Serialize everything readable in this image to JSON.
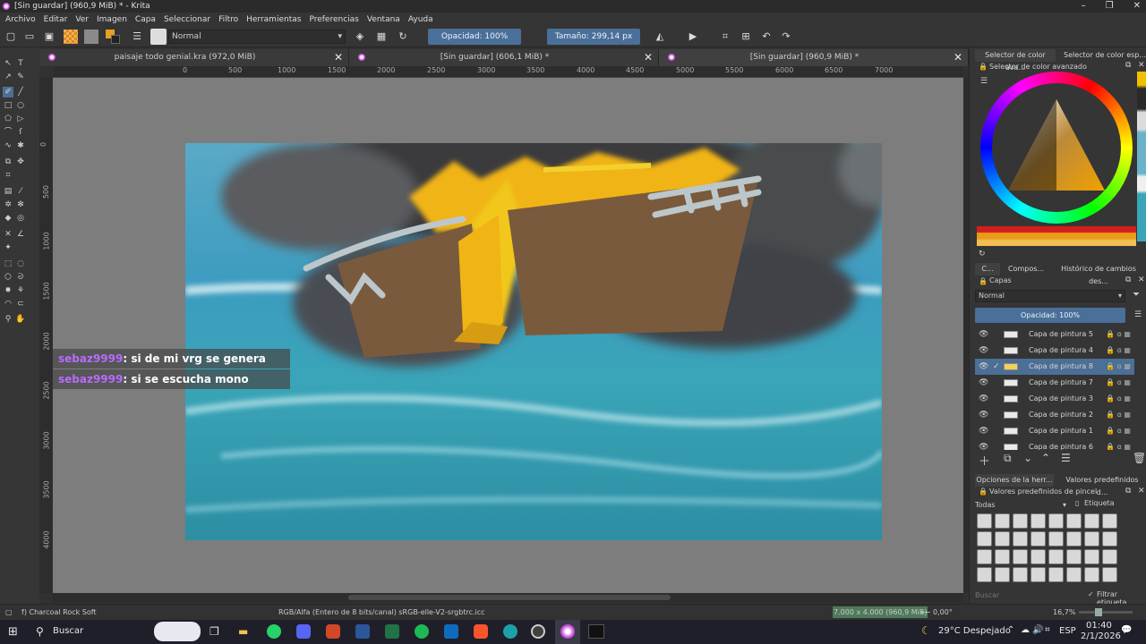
{
  "window": {
    "title": "[Sin guardar]  (960,9 MiB) * - Krita",
    "min": "–",
    "max": "❐",
    "close": "✕"
  },
  "menu": [
    "Archivo",
    "Editar",
    "Ver",
    "Imagen",
    "Capa",
    "Seleccionar",
    "Filtro",
    "Herramientas",
    "Preferencias",
    "Ventana",
    "Ayuda"
  ],
  "toolbar": {
    "blend_mode": "Normal",
    "opacity": "Opacidad: 100%",
    "size": "Tamaño: 299,14 px"
  },
  "tabs": [
    {
      "label": "paisaje todo genial.kra (972,0 MiB)"
    },
    {
      "label": "[Sin guardar]  (606,1 MiB) *"
    },
    {
      "label": "[Sin guardar]  (960,9 MiB) *"
    }
  ],
  "ruler_top": [
    "0",
    "500",
    "1000",
    "1500",
    "2000",
    "2500",
    "3000",
    "3500",
    "4000",
    "4500",
    "5000",
    "5500",
    "6000",
    "6500",
    "7000"
  ],
  "ruler_left": [
    "0",
    "500",
    "1000",
    "1500",
    "2000",
    "2500",
    "3000",
    "3500",
    "4000"
  ],
  "chat": [
    {
      "user": "sebaz9999",
      "msg": ": si de mi vrg se genera"
    },
    {
      "user": "sebaz9999",
      "msg": ": si se escucha mono"
    }
  ],
  "right_panel": {
    "top_tabs": [
      "Selector de color ava...",
      "Selector de color esp..."
    ],
    "color_header": "Selector de color avanzado",
    "mid_tabs": [
      "C...",
      "Compos...",
      "Histórico de cambios des..."
    ],
    "layers_header": "Capas",
    "layers_blend": "Normal",
    "layers_opacity": "Opacidad:  100%",
    "layers": [
      {
        "name": "Capa de pintura 5",
        "selected": false
      },
      {
        "name": "Capa de pintura 4",
        "selected": false
      },
      {
        "name": "Capa de pintura 8",
        "selected": true
      },
      {
        "name": "Capa de pintura 7",
        "selected": false
      },
      {
        "name": "Capa de pintura 3",
        "selected": false
      },
      {
        "name": "Capa de pintura 2",
        "selected": false
      },
      {
        "name": "Capa de pintura 1",
        "selected": false
      },
      {
        "name": "Capa de pintura 6",
        "selected": false
      }
    ],
    "bottom_tabs": [
      "Opciones de la herr...",
      "Valores predefinidos d..."
    ],
    "brush_header": "Valores predefinidos de pincel",
    "brush_filter": "Todas",
    "brush_tag": "Etiqueta",
    "search_placeholder": "Buscar",
    "filter_tag": "Filtrar etiqueta"
  },
  "status": {
    "brush": "f) Charcoal Rock Soft",
    "color_model": "RGB/Alfa (Entero de 8 bits/canal)  sRGB-elle-V2-srgbtrc.icc",
    "dimensions": "7.000 x 4.000 (960,9 MiB)",
    "rotation": "0,00°",
    "zoom": "16,7%"
  },
  "taskbar": {
    "search": "Buscar",
    "weather": "29°C  Despejado",
    "lang": "ESP",
    "time": "01:40",
    "date": "2/1/2026"
  }
}
